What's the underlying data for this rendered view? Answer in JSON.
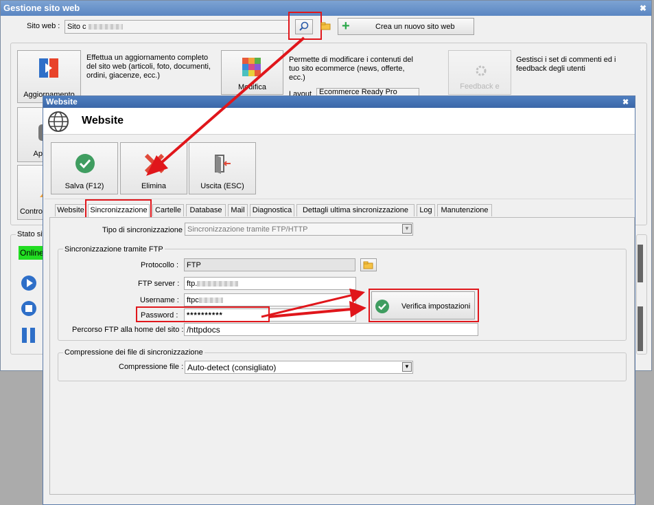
{
  "back_window": {
    "title": "Gestione sito web",
    "site_label": "Sito web :",
    "site_value": "Sito c",
    "new_site_button": "Crea un nuovo sito web",
    "update_button": "Aggiornamento",
    "update_desc": "Effettua un aggiornamento completo del sito web (articoli, foto, documenti, ordini, giacenze, ecc.)",
    "modify_button": "Modifica",
    "modify_desc": "Permette di modificare i contenuti del tuo sito ecommerce (news, offerte, ecc.)",
    "layout_label": "Layout",
    "layout_value": "Ecommerce Ready Pro",
    "feedback_button": "Feedback e",
    "feedback_desc": "Gestisci i set di commenti ed i feedback degli utenti",
    "ap_button": "Ap",
    "contro_button": "Contro",
    "status_label": "Stato sit",
    "status_online": "Online"
  },
  "dialog": {
    "title": "Website",
    "header": "Website",
    "save_button": "Salva (F12)",
    "delete_button": "Elimina",
    "exit_button": "Uscita (ESC)",
    "tabs": [
      "Website",
      "Sincronizzazione",
      "Cartelle",
      "Database",
      "Mail",
      "Diagnostica",
      "Dettagli ultima sincronizzazione",
      "Log",
      "Manutenzione"
    ],
    "sync_type_label": "Tipo di sincronizzazione :",
    "sync_type_value": "Sincronizzazione tramite FTP/HTTP",
    "ftp_group_title": "Sincronizzazione tramite FTP",
    "protocol_label": "Protocollo :",
    "protocol_value": "FTP",
    "ftp_server_label": "FTP server :",
    "ftp_server_value": "ftp.",
    "username_label": "Username :",
    "username_value": "ftpc",
    "password_label": "Password :",
    "password_value": "**********",
    "home_path_label": "Percorso FTP alla home del sito :",
    "home_path_value": "/httpdocs",
    "verify_button": "Verifica impostazioni",
    "compress_group_title": "Compressione dei file di sincronizzazione",
    "compress_label": "Compressione file :",
    "compress_value": "Auto-detect (consigliato)"
  },
  "colors": {
    "highlight_red": "#e0161b",
    "title_blue": "#4f7fc0",
    "online_green": "#22dd22"
  }
}
